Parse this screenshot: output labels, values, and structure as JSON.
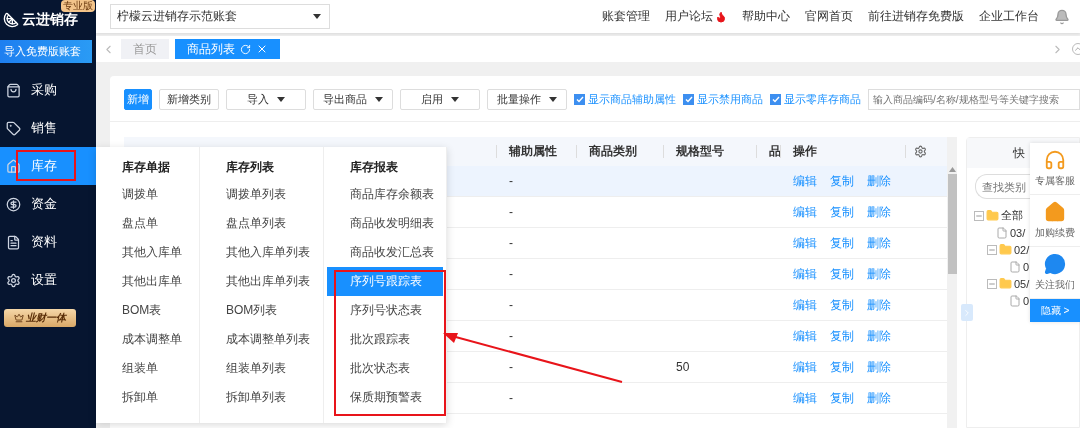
{
  "sidebar": {
    "logo": "云进销存",
    "edition_badge": "专业版",
    "import_button": "导入免费版账套",
    "items": [
      {
        "label": "采购",
        "selected": false
      },
      {
        "label": "销售",
        "selected": false
      },
      {
        "label": "库存",
        "selected": true
      },
      {
        "label": "资金",
        "selected": false
      },
      {
        "label": "资料",
        "selected": false
      },
      {
        "label": "设置",
        "selected": false
      }
    ],
    "promo_badge": "业财一体"
  },
  "topbar": {
    "account_select": "柠檬云进销存示范账套",
    "links": [
      {
        "label": "账套管理",
        "hot": false
      },
      {
        "label": "用户论坛",
        "hot": true
      },
      {
        "label": "帮助中心",
        "hot": false
      },
      {
        "label": "官网首页",
        "hot": false
      },
      {
        "label": "前往进销存免费版",
        "hot": false
      },
      {
        "label": "企业工作台",
        "hot": false
      }
    ]
  },
  "tabs": [
    {
      "label": "首页",
      "selected": false
    },
    {
      "label": "商品列表",
      "selected": true
    }
  ],
  "toolbar": {
    "buttons": [
      {
        "label": "新增",
        "kind": "primary"
      },
      {
        "label": "新增类别",
        "kind": "plain"
      },
      {
        "label": "导入",
        "kind": "dropdown"
      },
      {
        "label": "导出商品",
        "kind": "dropdown"
      },
      {
        "label": "启用",
        "kind": "dropdown"
      },
      {
        "label": "批量操作",
        "kind": "dropdown"
      }
    ],
    "checkboxes": [
      {
        "label": "显示商品辅助属性",
        "checked": true
      },
      {
        "label": "显示禁用商品",
        "checked": true
      },
      {
        "label": "显示零库存商品",
        "checked": true
      }
    ],
    "search": {
      "placeholder": "输入商品编码/名称/规格型号等关键字搜索"
    }
  },
  "table": {
    "columns": [
      "辅助属性",
      "商品类别",
      "规格型号",
      "品",
      "操作"
    ],
    "rows": [
      {
        "selected": true,
        "cells": [
          "-",
          "",
          "",
          ""
        ],
        "actions": [
          "编辑",
          "复制",
          "删除"
        ]
      },
      {
        "selected": false,
        "cells": [
          "-",
          "",
          "",
          ""
        ],
        "actions": [
          "编辑",
          "复制",
          "删除"
        ]
      },
      {
        "selected": false,
        "cells": [
          "-",
          "",
          "",
          ""
        ],
        "actions": [
          "编辑",
          "复制",
          "删除"
        ]
      },
      {
        "selected": false,
        "cells": [
          "-",
          "",
          "",
          ""
        ],
        "actions": [
          "编辑",
          "复制",
          "删除"
        ]
      },
      {
        "selected": false,
        "cells": [
          "-",
          "",
          "",
          ""
        ],
        "actions": [
          "编辑",
          "复制",
          "删除"
        ]
      },
      {
        "selected": false,
        "cells": [
          "-",
          "",
          "",
          ""
        ],
        "actions": [
          "编辑",
          "复制",
          "删除"
        ]
      },
      {
        "selected": false,
        "cells": [
          "-",
          "",
          "50",
          ""
        ],
        "actions": [
          "编辑",
          "复制",
          "删除"
        ]
      },
      {
        "selected": false,
        "cells": [
          "-",
          "",
          "",
          ""
        ],
        "actions": [
          "编辑",
          "复制",
          "删除"
        ]
      }
    ]
  },
  "menu": {
    "columns": [
      {
        "heading": "库存单据",
        "items": [
          {
            "label": "调拨单",
            "selected": false
          },
          {
            "label": "盘点单",
            "selected": false
          },
          {
            "label": "其他入库单",
            "selected": false
          },
          {
            "label": "其他出库单",
            "selected": false
          },
          {
            "label": "BOM表",
            "selected": false
          },
          {
            "label": "成本调整单",
            "selected": false
          },
          {
            "label": "组装单",
            "selected": false
          },
          {
            "label": "拆卸单",
            "selected": false
          }
        ]
      },
      {
        "heading": "库存列表",
        "items": [
          {
            "label": "调拨单列表",
            "selected": false
          },
          {
            "label": "盘点单列表",
            "selected": false
          },
          {
            "label": "其他入库单列表",
            "selected": false
          },
          {
            "label": "其他出库单列表",
            "selected": false
          },
          {
            "label": "BOM列表",
            "selected": false
          },
          {
            "label": "成本调整单列表",
            "selected": false
          },
          {
            "label": "组装单列表",
            "selected": false
          },
          {
            "label": "拆卸单列表",
            "selected": false
          }
        ]
      },
      {
        "heading": "库存报表",
        "items": [
          {
            "label": "商品库存余额表",
            "selected": false
          },
          {
            "label": "商品收发明细表",
            "selected": false
          },
          {
            "label": "商品收发汇总表",
            "selected": false
          },
          {
            "label": "序列号跟踪表",
            "selected": true
          },
          {
            "label": "序列号状态表",
            "selected": false
          },
          {
            "label": "批次跟踪表",
            "selected": false
          },
          {
            "label": "批次状态表",
            "selected": false
          },
          {
            "label": "保质期预警表",
            "selected": false
          }
        ]
      }
    ]
  },
  "category_panel": {
    "title": "快",
    "search": {
      "placeholder": "查找类别"
    },
    "tree": [
      {
        "label": "全部",
        "expanded": true,
        "children": [
          {
            "label": "03/"
          },
          {
            "label": "02/",
            "expanded": true,
            "children": [
              {
                "label": "0"
              }
            ]
          },
          {
            "label": "05/",
            "expanded": true,
            "children": [
              {
                "label": "0"
              }
            ]
          }
        ]
      }
    ]
  },
  "service_widget": {
    "items": [
      "专属客服",
      "加购续费",
      "关注我们"
    ],
    "hide_button": "隐藏 >"
  }
}
